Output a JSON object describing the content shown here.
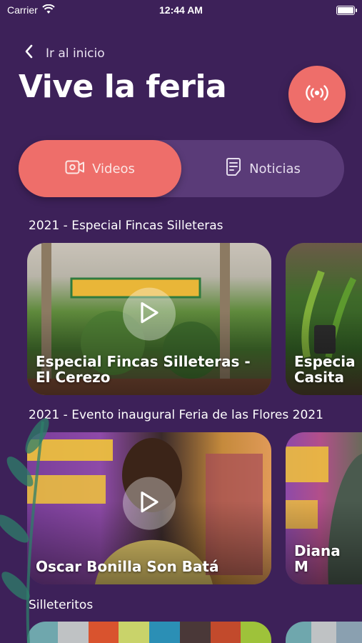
{
  "status_bar": {
    "carrier": "Carrier",
    "time": "12:44 AM"
  },
  "header": {
    "back_label": "Ir al inicio",
    "title": "Vive la feria"
  },
  "tabs": [
    {
      "label": "Videos",
      "active": true
    },
    {
      "label": "Noticias",
      "active": false
    }
  ],
  "sections": [
    {
      "title": "2021 - Especial Fincas Silleteras",
      "cards": [
        {
          "title": "Especial Fincas Silleteras -\nEl Cerezo"
        },
        {
          "title": "Especia\nCasita"
        }
      ]
    },
    {
      "title": "2021 - Evento inaugural Feria de las Flores 2021",
      "cards": [
        {
          "title": "Oscar Bonilla Son Batá"
        },
        {
          "title": "Diana M"
        }
      ]
    },
    {
      "title": "Silleteritos",
      "cards": []
    }
  ],
  "colors": {
    "background": "#3d2159",
    "accent": "#ee6e6a",
    "tab_track": "#5a3b78"
  },
  "icons": {
    "back": "chevron-left-icon",
    "live": "broadcast-icon",
    "videos": "video-camera-icon",
    "news": "news-document-icon",
    "play": "play-icon"
  }
}
